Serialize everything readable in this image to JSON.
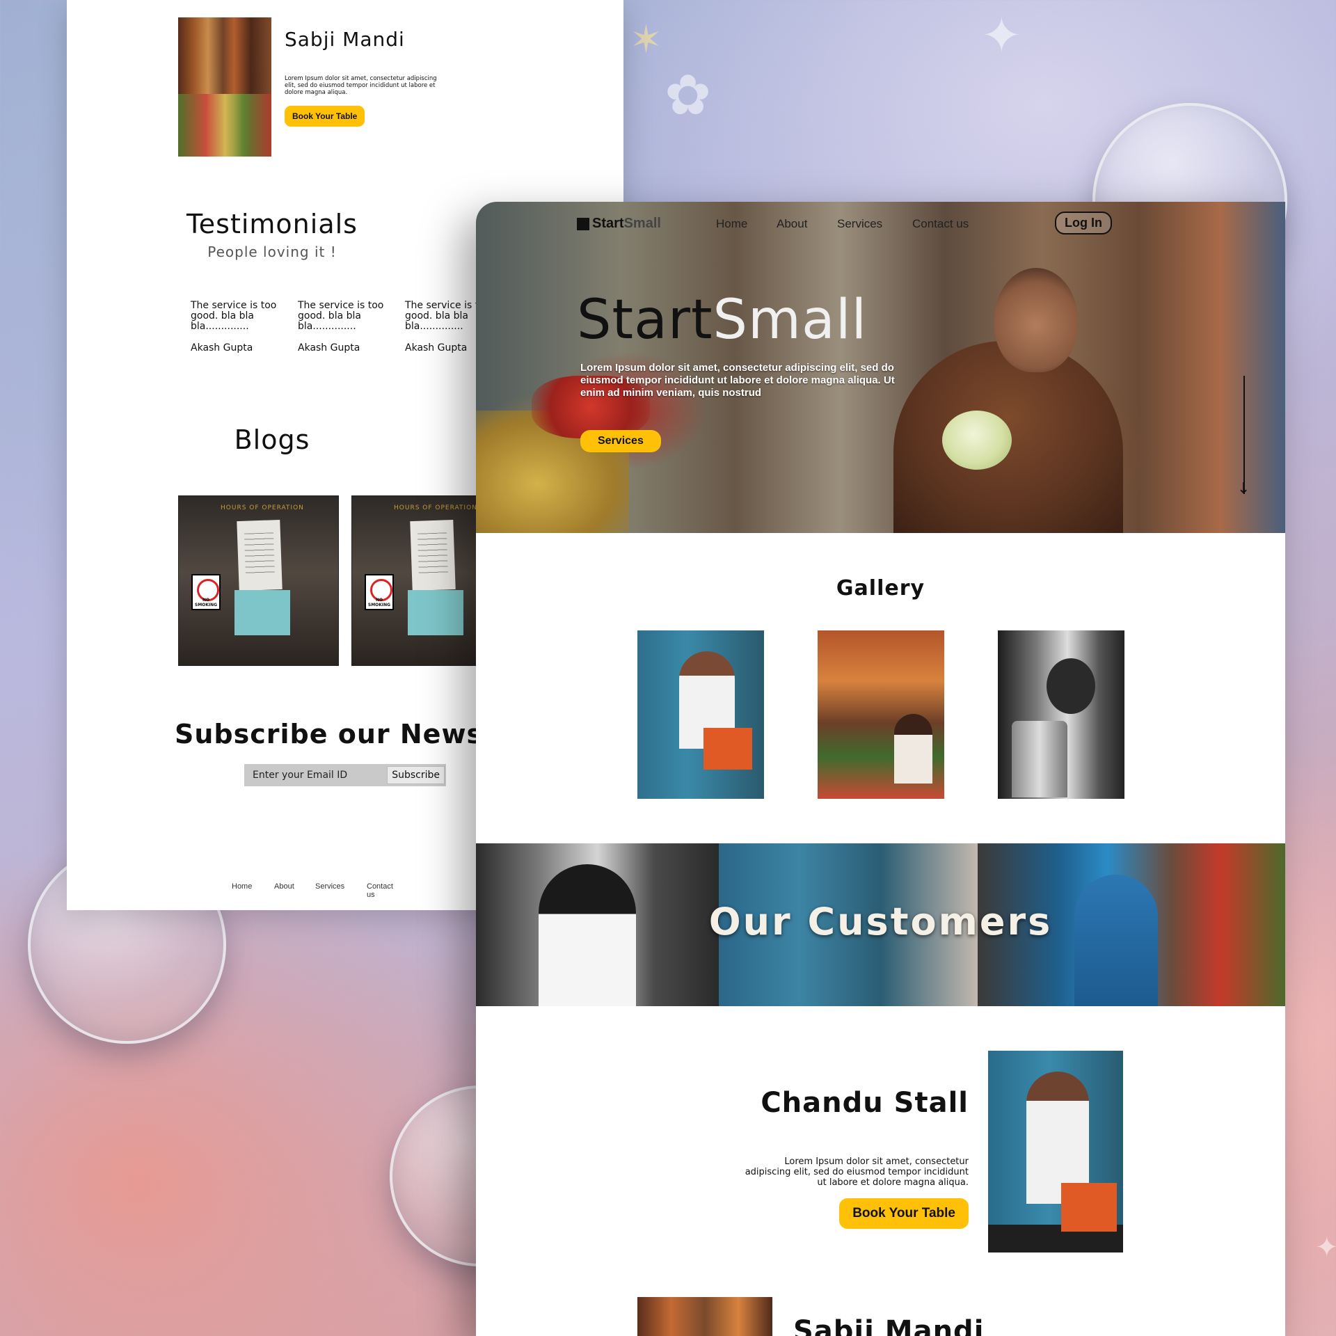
{
  "back_page": {
    "featured": {
      "title": "Sabji Mandi",
      "description": "Lorem Ipsum dolor sit amet, consectetur adipiscing elit, sed do eiusmod tempor incididunt ut labore et dolore magna aliqua.",
      "button": "Book Your Table"
    },
    "testimonials": {
      "title": "Testimonials",
      "subtitle": "People loving it !",
      "items": [
        {
          "quote": "The service is too good. bla bla bla..............",
          "author": "Akash Gupta"
        },
        {
          "quote": "The service is too good. bla bla bla..............",
          "author": "Akash Gupta"
        },
        {
          "quote": "The service is too good. bla bla bla..............",
          "author": "Akash Gupta"
        }
      ]
    },
    "blogs": {
      "title": "Blogs",
      "sign_text": "HOURS OF OPERATION"
    },
    "newsletter": {
      "title": "Subscribe our Newsletter",
      "placeholder": "Enter your Email ID",
      "button": "Subscribe"
    },
    "footer_links": [
      "Home",
      "About",
      "Services",
      "Contact us"
    ]
  },
  "front_page": {
    "nav": {
      "logo_start": "Start",
      "logo_small": "Small",
      "links": [
        "Home",
        "About",
        "Services",
        "Contact us"
      ],
      "login": "Log In"
    },
    "hero": {
      "title_start": "Start",
      "title_small": "Small",
      "text": "Lorem Ipsum dolor sit amet, consectetur adipiscing elit, sed do eiusmod tempor incididunt ut labore et dolore magna aliqua. Ut enim ad minim veniam, quis nostrud",
      "button": "Services"
    },
    "gallery": {
      "title": "Gallery"
    },
    "customers": {
      "title": "Our Customers"
    },
    "stall": {
      "title": "Chandu Stall",
      "description": "Lorem Ipsum dolor sit amet, consectetur adipiscing elit, sed do eiusmod tempor incididunt ut labore et dolore magna aliqua.",
      "button": "Book Your Table"
    },
    "next_stall": {
      "title": "Sabji Mandi"
    }
  },
  "colors": {
    "accent": "#ffc107",
    "text": "#111111"
  }
}
